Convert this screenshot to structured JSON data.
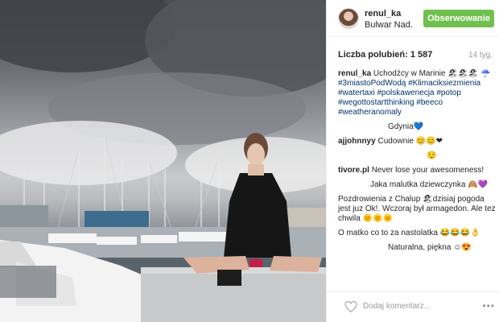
{
  "post": {
    "username": "renul_ka",
    "location": "Bulwar Nad...",
    "follow_label": "Obserwowanie",
    "likes_label": "Liczba polubień:",
    "likes_count": "1 587",
    "time_ago": "14 tyg."
  },
  "caption": {
    "user": "renul_ka",
    "text": "Uchodźcy w Marinie 🏖🏖🏖",
    "hashtags": [
      "☔#3miastoPodWodą",
      "#Klimaciksiezmienia",
      "#watertaxi",
      "#polskawenecja",
      "#potop",
      "#wegottostartthinking",
      "#beeco",
      "#weatheranomaly"
    ]
  },
  "comments": [
    {
      "user": "",
      "text": "Gdynia💙"
    },
    {
      "user": "ajjohnnyy",
      "text": "Cudownie 😊😊❤"
    },
    {
      "user": "",
      "text": "😌"
    },
    {
      "user": "tivore.pl",
      "text": "Never lose your awesomeness!"
    },
    {
      "user": "",
      "text": "Jaka malutka dziewczynka 🙈💜"
    },
    {
      "user": "",
      "text": "Pozdrowienia z Chalup 🏖dzisiaj pogoda jest juz Ok!. Wczoraj był armagedon. Ale tez chwila 🌞🌞🌞"
    },
    {
      "user": "",
      "text": "O matko co to za nastolatka 😂😂😂👌"
    },
    {
      "user": "",
      "text": "Naturalna, piękna ☺😍"
    }
  ],
  "footer": {
    "add_comment_placeholder": "Dodaj komentarz...",
    "more": "•••"
  },
  "icons": {
    "like": "heart-outline-icon",
    "more": "ellipsis-icon"
  },
  "colors": {
    "follow_button": "#70c050",
    "hashtag": "#003569",
    "muted": "#999999"
  }
}
